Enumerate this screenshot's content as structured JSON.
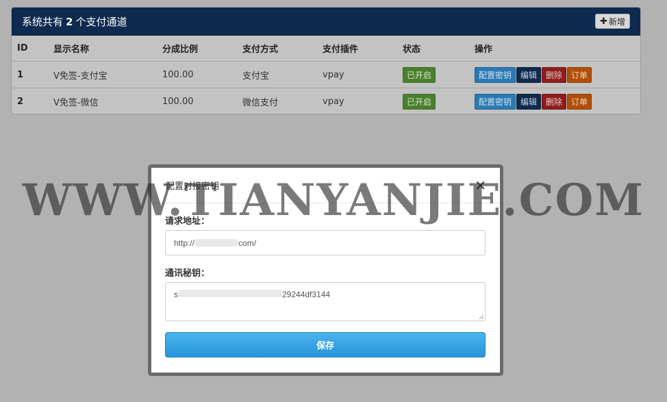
{
  "panel": {
    "title_prefix": "系统共有",
    "count": "2",
    "title_suffix": "个支付通道",
    "add_button_icon": "plus-icon",
    "add_button_label": "新增"
  },
  "table": {
    "headers": [
      "ID",
      "显示名称",
      "分成比例",
      "支付方式",
      "支付插件",
      "状态",
      "操作"
    ],
    "rows": [
      {
        "id": "1",
        "name": "V免签-支付宝",
        "ratio": "100.00",
        "method": "支付宝",
        "plugin": "vpay",
        "status": "已开启"
      },
      {
        "id": "2",
        "name": "V免签-微信",
        "ratio": "100.00",
        "method": "微信支付",
        "plugin": "vpay",
        "status": "已开启"
      }
    ],
    "actions": {
      "config": "配置密钥",
      "edit": "编辑",
      "delete": "删除",
      "order": "订单"
    }
  },
  "modal": {
    "title": "配置对接密钥",
    "close_icon": "close-icon",
    "url_label": "请求地址：",
    "url_prefix": "http://",
    "url_suffix": "com/",
    "key_label": "通讯秘钥：",
    "key_prefix": "s",
    "key_suffix": "29244df3144",
    "save_label": "保存"
  },
  "watermark": "WWW.TIANYANJIE.COM",
  "colors": {
    "header_bg": "#0e2a4f",
    "status_on": "#4a7f2e",
    "config_btn": "#2b7ab4",
    "edit_btn": "#0e2a4f",
    "delete_btn": "#8f1d1c",
    "order_btn": "#b04e08",
    "save_btn": "#2795d9"
  }
}
